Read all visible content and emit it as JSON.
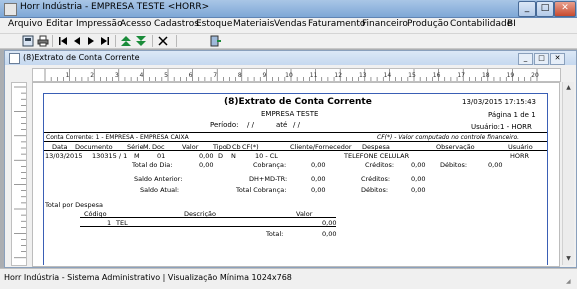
{
  "window": {
    "title": "Horr Indústria - EMPRESA TESTE <HORR>",
    "min": "_",
    "max": "□",
    "close": "✕"
  },
  "menu": [
    "Arquivo",
    "Editar",
    "Impressão",
    "Acesso",
    "Cadastros",
    "Estoque",
    "Materiais",
    "Vendas",
    "Faturamento",
    "Financeiro",
    "Produção",
    "Contabilidade",
    "BI"
  ],
  "toolbar": {
    "icons": [
      "close-preview-icon",
      "print-icon",
      "first-page-icon",
      "prev-page-icon",
      "next-page-icon",
      "last-page-icon",
      "zoom-in-icon",
      "zoom-out-icon",
      "cancel-icon",
      "exit-icon"
    ]
  },
  "child": {
    "title": "(8)Extrato de Conta Corrente",
    "min": "_",
    "max": "□",
    "close": "✕"
  },
  "ruler": {
    "marks": [
      "1",
      "2",
      "3",
      "4",
      "5",
      "6",
      "7",
      "8",
      "9",
      "10",
      "11",
      "12",
      "13",
      "14",
      "15",
      "16",
      "17",
      "18",
      "19",
      "20"
    ]
  },
  "report": {
    "title": "(8)Extrato de Conta Corrente",
    "company": "EMPRESA TESTE",
    "periodo_label": "Período:",
    "periodo_from": "/      /",
    "ate_label": "até",
    "periodo_to": "/      /",
    "datetime": "13/03/2015 17:15:43",
    "page": "Página 1 de 1",
    "user": "Usuário:1 - HORR",
    "conta": "Conta Corrente: 1 - EMPRESA - EMPRESA CAIXA",
    "note": "CF(*) - Valor computado no controle financeiro.",
    "headers": {
      "data": "Data",
      "documento": "Documento",
      "serie": "Série",
      "m": "M.",
      "doc": "Doc",
      "valor": "Valor",
      "tipo": "Tipo",
      "d": "D",
      "cb": "Cb",
      "cf": "CF(*)",
      "cliente": "Cliente/Fornecedor",
      "despesa": "Despesa",
      "observacao": "Observação",
      "usuario": "Usuário"
    },
    "row": {
      "data": "13/03/2015",
      "documento": "130315 / 1",
      "serie": "M",
      "doc": "01",
      "valor": "0,00",
      "tipo": "D",
      "cb": "N",
      "cliente": "10 - CL",
      "despesa": "TELEFONE CELULAR",
      "usuario": "HORR"
    },
    "totals": {
      "total_dia_label": "Total do Dia:",
      "total_dia": "0,00",
      "cobranca_label": "Cobrança:",
      "cobranca": "0,00",
      "creditos_label": "Créditos:",
      "creditos": "0,00",
      "debitos_label": "Débitos:",
      "debitos": "0,00",
      "saldo_anterior_label": "Saldo Anterior:",
      "dhmdtr_label": "DH+MD-TR:",
      "dhmdtr": "0,00",
      "creditos2_label": "Créditos:",
      "creditos2": "0,00",
      "saldo_atual_label": "Saldo Atual:",
      "total_cobranca_label": "Total Cobrança:",
      "total_cobranca": "0,00",
      "debitos2_label": "Débitos:",
      "debitos2": "0,00"
    },
    "despesa_section": {
      "title": "Total por Despesa",
      "codigo": "Código",
      "descricao": "Descrição",
      "valor": "Valor",
      "row": {
        "codigo": "1",
        "descricao": "TEL",
        "valor": "0,00"
      },
      "total_label": "Total:",
      "total": "0,00"
    }
  },
  "status": {
    "text": "Horr Indústria - Sistema Administrativo | Visualização Mínima 1024x768"
  }
}
